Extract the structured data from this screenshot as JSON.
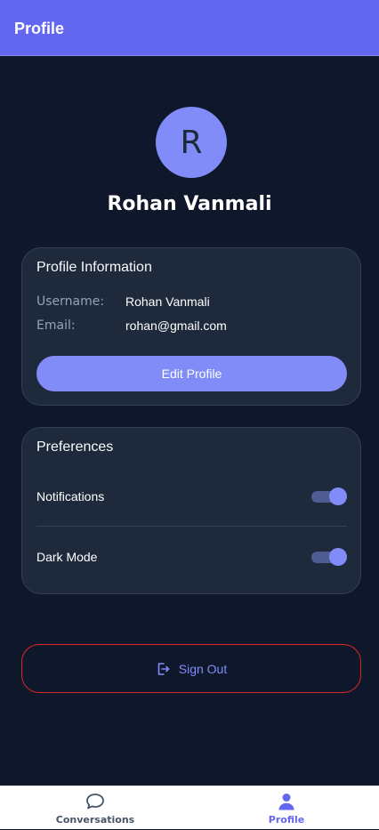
{
  "header": {
    "title": "Profile"
  },
  "profile": {
    "avatar_initial": "R",
    "name": "Rohan Vanmali"
  },
  "info_card": {
    "title": "Profile Information",
    "username_label": "Username:",
    "username_value": "Rohan Vanmali",
    "email_label": "Email:",
    "email_value": "rohan@gmail.com",
    "edit_button": "Edit Profile"
  },
  "preferences": {
    "title": "Preferences",
    "items": [
      {
        "label": "Notifications",
        "enabled": true
      },
      {
        "label": "Dark Mode",
        "enabled": true
      }
    ]
  },
  "signout": {
    "label": "Sign Out",
    "icon": "sign-out-icon"
  },
  "nav": {
    "items": [
      {
        "label": "Conversations",
        "icon": "chat-bubble-icon",
        "active": false
      },
      {
        "label": "Profile",
        "icon": "user-icon",
        "active": true
      }
    ]
  },
  "colors": {
    "primary": "#6366f1",
    "accent": "#818cf8",
    "background": "#0f172a",
    "card": "#1e293b",
    "danger_border": "#dc2626"
  }
}
